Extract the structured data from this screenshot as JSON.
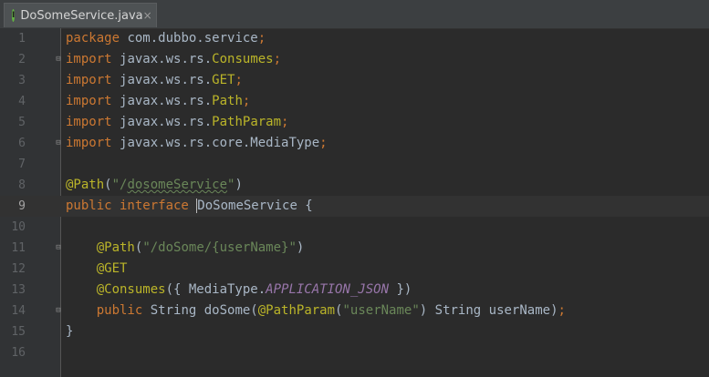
{
  "tab": {
    "icon_letter": "I",
    "filename": "DoSomeService.java",
    "close_glyph": "×"
  },
  "lines": [
    {
      "n": "1",
      "parts": [
        {
          "t": "package ",
          "c": "kw"
        },
        {
          "t": "com.dubbo.service",
          "c": "pk"
        },
        {
          "t": ";",
          "c": "kw"
        }
      ]
    },
    {
      "n": "2",
      "parts": [
        {
          "t": "import ",
          "c": "kw"
        },
        {
          "t": "javax.ws.rs.",
          "c": "pk"
        },
        {
          "t": "Consumes",
          "c": "ann"
        },
        {
          "t": ";",
          "c": "kw"
        }
      ],
      "fold": true
    },
    {
      "n": "3",
      "parts": [
        {
          "t": "import ",
          "c": "kw"
        },
        {
          "t": "javax.ws.rs.",
          "c": "pk"
        },
        {
          "t": "GET",
          "c": "ann"
        },
        {
          "t": ";",
          "c": "kw"
        }
      ]
    },
    {
      "n": "4",
      "parts": [
        {
          "t": "import ",
          "c": "kw"
        },
        {
          "t": "javax.ws.rs.",
          "c": "pk"
        },
        {
          "t": "Path",
          "c": "ann"
        },
        {
          "t": ";",
          "c": "kw"
        }
      ]
    },
    {
      "n": "5",
      "parts": [
        {
          "t": "import ",
          "c": "kw"
        },
        {
          "t": "javax.ws.rs.",
          "c": "pk"
        },
        {
          "t": "PathParam",
          "c": "ann"
        },
        {
          "t": ";",
          "c": "kw"
        }
      ]
    },
    {
      "n": "6",
      "parts": [
        {
          "t": "import ",
          "c": "kw"
        },
        {
          "t": "javax.ws.rs.core.MediaType",
          "c": "pk"
        },
        {
          "t": ";",
          "c": "kw"
        }
      ],
      "fold": true
    },
    {
      "n": "7",
      "parts": []
    },
    {
      "n": "8",
      "parts": [
        {
          "t": "@Path",
          "c": "ann"
        },
        {
          "t": "(",
          "c": "pk"
        },
        {
          "t": "\"/",
          "c": "str"
        },
        {
          "t": "dosomeService",
          "c": "str typo"
        },
        {
          "t": "\"",
          "c": "str"
        },
        {
          "t": ")",
          "c": "pk"
        }
      ]
    },
    {
      "n": "9",
      "parts": [
        {
          "t": "public interface ",
          "c": "kw"
        },
        {
          "t": "DoSomeService",
          "c": "cls caret"
        },
        {
          "t": " {",
          "c": "pk"
        }
      ],
      "current": true
    },
    {
      "n": "10",
      "parts": []
    },
    {
      "n": "11",
      "parts": [
        {
          "t": "    ",
          "c": "pk"
        },
        {
          "t": "@Path",
          "c": "ann"
        },
        {
          "t": "(",
          "c": "pk"
        },
        {
          "t": "\"/doSome/{userName}\"",
          "c": "str"
        },
        {
          "t": ")",
          "c": "pk"
        }
      ],
      "fold": true
    },
    {
      "n": "12",
      "parts": [
        {
          "t": "    ",
          "c": "pk"
        },
        {
          "t": "@GET",
          "c": "ann"
        }
      ]
    },
    {
      "n": "13",
      "parts": [
        {
          "t": "    ",
          "c": "pk"
        },
        {
          "t": "@Consumes",
          "c": "ann"
        },
        {
          "t": "({ MediaType.",
          "c": "pk"
        },
        {
          "t": "APPLICATION_JSON",
          "c": "const"
        },
        {
          "t": " })",
          "c": "pk"
        }
      ]
    },
    {
      "n": "14",
      "parts": [
        {
          "t": "    ",
          "c": "pk"
        },
        {
          "t": "public ",
          "c": "kw"
        },
        {
          "t": "String doSome(",
          "c": "pk"
        },
        {
          "t": "@PathParam",
          "c": "ann"
        },
        {
          "t": "(",
          "c": "pk"
        },
        {
          "t": "\"userName\"",
          "c": "str"
        },
        {
          "t": ") String userName)",
          "c": "pk"
        },
        {
          "t": ";",
          "c": "kw"
        }
      ],
      "fold": true
    },
    {
      "n": "15",
      "parts": [
        {
          "t": "}",
          "c": "pk"
        }
      ]
    },
    {
      "n": "16",
      "parts": []
    }
  ],
  "colors": {
    "background": "#2b2b2b",
    "gutter": "#313335",
    "keyword": "#cc7832",
    "annotation": "#bbb529",
    "string": "#6a8759",
    "constant": "#9876aa",
    "text": "#a9b7c6"
  }
}
